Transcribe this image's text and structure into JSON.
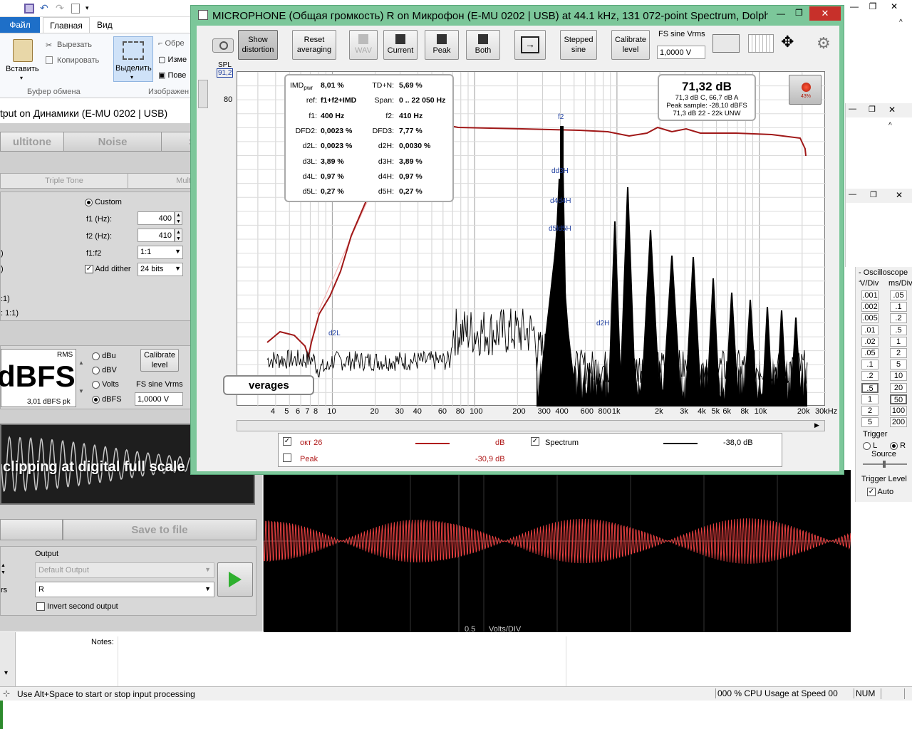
{
  "paint": {
    "tabs": {
      "file": "Файл",
      "home": "Главная",
      "view": "Вид"
    },
    "clipboard": {
      "paste": "Вставить",
      "cut": "Вырезать",
      "copy": "Копировать",
      "group": "Буфер обмена"
    },
    "image": {
      "select": "Выделить",
      "crop": "Обре",
      "resize": "Изме",
      "rotate": "Пове",
      "group": "Изображен"
    }
  },
  "generator": {
    "title": "tput on Динамики (E-MU 0202 | USB)",
    "tabs": [
      "ultitone",
      "Noise",
      "Sweeps"
    ],
    "subtabs": [
      "Triple Tone",
      "Multitone"
    ],
    "custom_label": "Custom",
    "f1_label": "f1 (Hz):",
    "f1_value": "400",
    "f2_label": "f2 (Hz):",
    "f2_value": "410",
    "ratio_label": "f1:f2",
    "ratio_value": "1:1",
    "dither_label": "Add dither",
    "dither_value": "24 bits",
    "left_frag": [
      ")",
      ")",
      ":1)",
      ": 1:1)"
    ],
    "level_display": "dBFS",
    "level_rms": "RMS",
    "level_pk": "3,01 dBFS pk",
    "units": [
      "dBu",
      "dBV",
      "Volts",
      "dBFS"
    ],
    "calibrate": "Calibrate level",
    "fs_label": "FS sine Vrms",
    "fs_value": "1,0000 V",
    "warning": "clipping at digital full scale",
    "save_file": "Save to file",
    "output_label": "Output",
    "output_default": "Default Output",
    "output_value": "R",
    "rs_frag": "rs",
    "invert": "Invert second output"
  },
  "spectrum": {
    "title": "MICROPHONE (Общая громкость) R on Микрофон (E-MU 0202 | USB) at 44.1 kHz, 131 072-point Spectrum, Dolph-...",
    "toolbar": {
      "show_distortion": "Show distortion",
      "reset_averaging": "Reset averaging",
      "wav": "WAV",
      "current": "Current",
      "peak": "Peak",
      "both": "Both",
      "stepped_sine": "Stepped sine",
      "calibrate_level": "Calibrate level",
      "fs_label": "FS sine Vrms",
      "fs_value": "1,0000 V"
    },
    "spl_label": "SPL",
    "spl_value": "91,2",
    "y_tick": "80",
    "stats": [
      {
        "l": "IMD",
        "sub": "pwr",
        "lv": "8,01 %",
        "r": "TD+N:",
        "rv": "5,69 %"
      },
      {
        "l": "ref:",
        "lv": "f1+f2+IMD",
        "r": "Span:",
        "rv": "0 .. 22 050 Hz"
      },
      {
        "l": "f1:",
        "lv": "400 Hz",
        "r": "f2:",
        "rv": "410 Hz"
      },
      {
        "l": "DFD2:",
        "lv": "0,0023 %",
        "r": "DFD3:",
        "rv": "7,77 %"
      },
      {
        "l": "d2L:",
        "lv": "0,0023 %",
        "r": "d2H:",
        "rv": "0,0030 %"
      },
      {
        "l": "d3L:",
        "lv": "3,89 %",
        "r": "d3H:",
        "rv": "3,89 %"
      },
      {
        "l": "d4L:",
        "lv": "0,97 %",
        "r": "d4H:",
        "rv": "0,97 %"
      },
      {
        "l": "d5L:",
        "lv": "0,27 %",
        "r": "d5H:",
        "rv": "0,27 %"
      }
    ],
    "level_box": {
      "main": "71,32 dB",
      "l1": "71,3 dB C, 66,7 dB A",
      "l2": "Peak sample: -28,10 dBFS",
      "l3": "71,3 dB 22 - 22k UNW"
    },
    "rec_pct": "43%",
    "markers": {
      "f2": "f2",
      "d3": "dd3H",
      "d4": "d4d4H",
      "d5": "d5ld5H",
      "d2L": "d2L",
      "d2H": "d2H"
    },
    "averages": "verages",
    "x_ticks": [
      "4",
      "5",
      "6",
      "7",
      "8",
      "10",
      "20",
      "30",
      "40",
      "60",
      "80",
      "100",
      "200",
      "300",
      "400",
      "600",
      "800",
      "1k",
      "2k",
      "3k",
      "4k",
      "5k",
      "6k",
      "8k",
      "10k",
      "20k",
      "30kHz"
    ],
    "legend": [
      {
        "name": "окт 26",
        "unit": "dB",
        "checked": true,
        "color": "#b01a1a"
      },
      {
        "name": "Spectrum",
        "unit": "-38,0 dB",
        "checked": true,
        "color": "#000000"
      },
      {
        "name": "Peak",
        "unit": "-30,9 dB",
        "checked": false,
        "color": "#b01a1a"
      }
    ]
  },
  "oscilloscope": {
    "title": "- Oscilloscope -",
    "vdiv": "V/Div",
    "msdiv": "ms/Div",
    "v_values": [
      ".001",
      ".002",
      ".005",
      ".01",
      ".02",
      ".05",
      ".1",
      ".2",
      ".5",
      "1",
      "2",
      "5"
    ],
    "ms_values": [
      ".05",
      ".1",
      ".2",
      ".5",
      "1",
      "2",
      "5",
      "10",
      "20",
      "50",
      "100",
      "200"
    ],
    "trigger": "Trigger",
    "source": "Source",
    "l": "L",
    "r": "R",
    "trigger_level": "Trigger Level",
    "auto": "Auto",
    "scale": "0.5",
    "scale_unit": "Volts/DIV"
  },
  "main": {
    "notes": "Notes:",
    "status": "Use Alt+Space to start or stop input processing",
    "cpu": "000 % CPU Usage at Speed 00",
    "num": "NUM"
  }
}
